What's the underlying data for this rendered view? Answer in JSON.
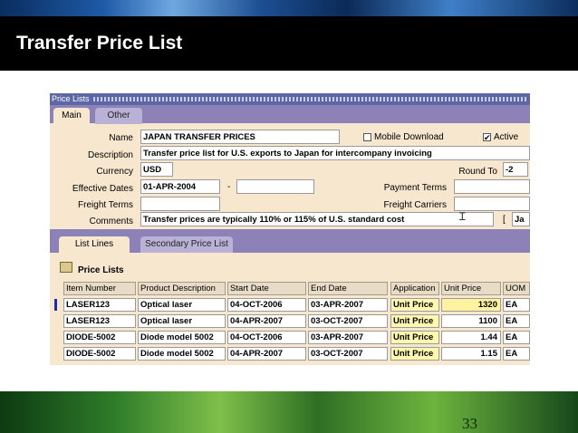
{
  "slide": {
    "title": "Transfer Price List",
    "page_number": "33"
  },
  "window": {
    "title": "Price Lists"
  },
  "tabs": [
    {
      "label": "Main",
      "active": true
    },
    {
      "label": "Other",
      "active": false
    }
  ],
  "header": {
    "name_label": "Name",
    "name_value": "JAPAN TRANSFER PRICES",
    "mobile_download_label": "Mobile Download",
    "mobile_download_checked": false,
    "active_label": "Active",
    "active_checked": true,
    "description_label": "Description",
    "description_value": "Transfer price list for U.S. exports to Japan for intercompany invoicing",
    "currency_label": "Currency",
    "currency_value": "USD",
    "round_to_label": "Round To",
    "round_to_value": "-2",
    "effective_dates_label": "Effective Dates",
    "effective_from": "01-APR-2004",
    "effective_to": "",
    "date_separator": "-",
    "payment_terms_label": "Payment Terms",
    "payment_terms_value": "",
    "freight_terms_label": "Freight Terms",
    "freight_terms_value": "",
    "freight_carriers_label": "Freight Carriers",
    "freight_carriers_value": "",
    "comments_label": "Comments",
    "comments_value": "Transfer prices are typically 110% or 115% of U.S. standard cost",
    "bracket": "[",
    "ja_value": "Ja"
  },
  "lower_tabs": [
    {
      "label": "List Lines",
      "active": true
    },
    {
      "label": "Secondary Price List",
      "active": false
    }
  ],
  "section": {
    "title": "Price Lists"
  },
  "table": {
    "columns": [
      "Item Number",
      "Product Description",
      "Start Date",
      "End Date",
      "Application",
      "Unit Price",
      "UOM"
    ],
    "rows": [
      {
        "item": "LASER123",
        "desc": "Optical laser",
        "start": "04-OCT-2006",
        "end": "03-APR-2007",
        "application": "Unit Price",
        "price": "1320",
        "uom": "EA",
        "current": true
      },
      {
        "item": "LASER123",
        "desc": "Optical laser",
        "start": "04-APR-2007",
        "end": "03-OCT-2007",
        "application": "Unit Price",
        "price": "1100",
        "uom": "EA",
        "current": false
      },
      {
        "item": "DIODE-5002",
        "desc": "Diode model 5002",
        "start": "04-OCT-2006",
        "end": "03-APR-2007",
        "application": "Unit Price",
        "price": "1.44",
        "uom": "EA",
        "current": false
      },
      {
        "item": "DIODE-5002",
        "desc": "Diode model 5002",
        "start": "04-APR-2007",
        "end": "03-OCT-2007",
        "application": "Unit Price",
        "price": "1.15",
        "uom": "EA",
        "current": false
      }
    ]
  },
  "colors": {
    "form_bg": "#f7e7cf",
    "tab_strip": "#8c82b8",
    "window_title": "#5d67a6",
    "highlight_yellow": "#fff9b0",
    "current_row_marker": "#1a2bb0"
  },
  "icons": {
    "section": "folder-icon",
    "text_cursor": "text-cursor-icon",
    "checkbox": "checkbox-icon"
  }
}
